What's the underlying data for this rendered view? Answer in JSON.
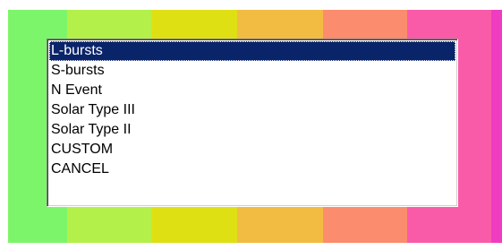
{
  "background": {
    "band_colors": [
      "#7df56a",
      "#b3f04a",
      "#dfe014",
      "#f2bb42",
      "#fb8c6d",
      "#f95ba8",
      "#f03cc0"
    ]
  },
  "listbox": {
    "selected_index": 0,
    "items": [
      {
        "label": "L-bursts"
      },
      {
        "label": "S-bursts"
      },
      {
        "label": "N Event"
      },
      {
        "label": "Solar Type III"
      },
      {
        "label": "Solar Type II"
      },
      {
        "label": "CUSTOM"
      },
      {
        "label": "CANCEL"
      }
    ]
  }
}
